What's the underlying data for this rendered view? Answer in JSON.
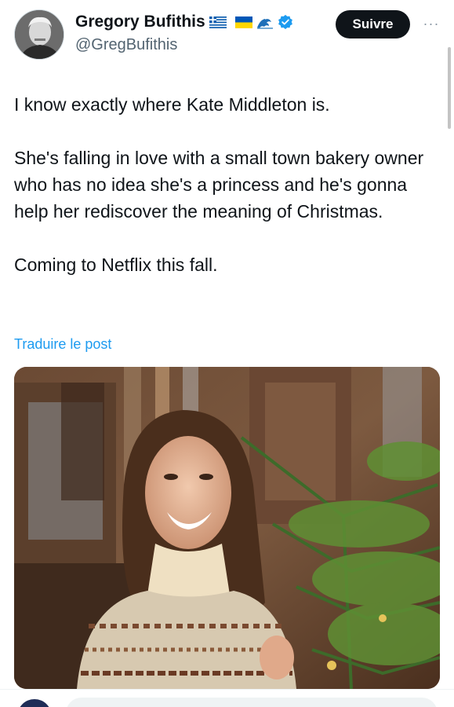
{
  "author": {
    "display_name": "Gregory Bufithis",
    "handle": "@GregBufithis",
    "badges": [
      "greece-flag-icon",
      "ukraine-flag-icon",
      "wave-icon",
      "verified-icon"
    ],
    "verified_color": "#1d9bf0"
  },
  "actions": {
    "follow_label": "Suivre",
    "more_label": "···"
  },
  "tweet": {
    "paragraphs": [
      "I know exactly where Kate Middleton is.",
      "She's falling in love with a small town bakery owner who has no idea she's a princess and he's gonna help her rediscover the meaning of Christmas.",
      "Coming to Netflix this fall."
    ],
    "translate_label": "Traduire le post"
  },
  "media": {
    "type": "photo",
    "subject": "smiling-woman-christmas-tree"
  },
  "colors": {
    "accent": "#1d9bf0",
    "text": "#0f1419",
    "secondary": "#536471",
    "button_bg": "#0f1419"
  }
}
